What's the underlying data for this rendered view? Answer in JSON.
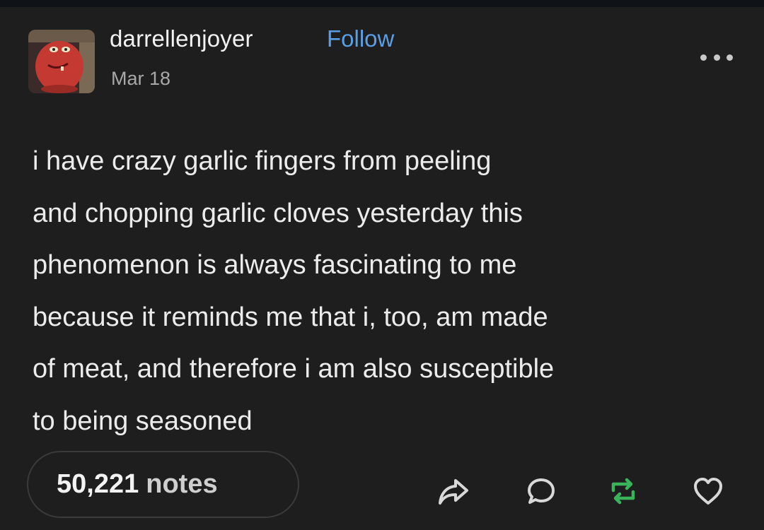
{
  "post": {
    "username": "darrellenjoyer",
    "follow_label": "Follow",
    "date": "Mar 18",
    "avatar_icon": "avatar-cartoon-face-icon",
    "menu_icon": "more-options-icon",
    "body_lines": [
      "i have crazy garlic fingers from peeling",
      "and chopping garlic cloves yesterday this",
      "phenomenon is always fascinating to me",
      "because it reminds me that i, too, am made",
      "of meat, and therefore i am also susceptible",
      "to being seasoned"
    ]
  },
  "footer": {
    "notes_count": "50,221",
    "notes_label": "notes",
    "actions": [
      "share-icon",
      "reply-icon",
      "reblog-icon",
      "like-icon"
    ]
  },
  "colors": {
    "background": "#1e1e1f",
    "follow": "#5a9ee6",
    "reblog": "#3bb35a",
    "text": "#e9e9e9",
    "muted": "#a8a8a8"
  }
}
